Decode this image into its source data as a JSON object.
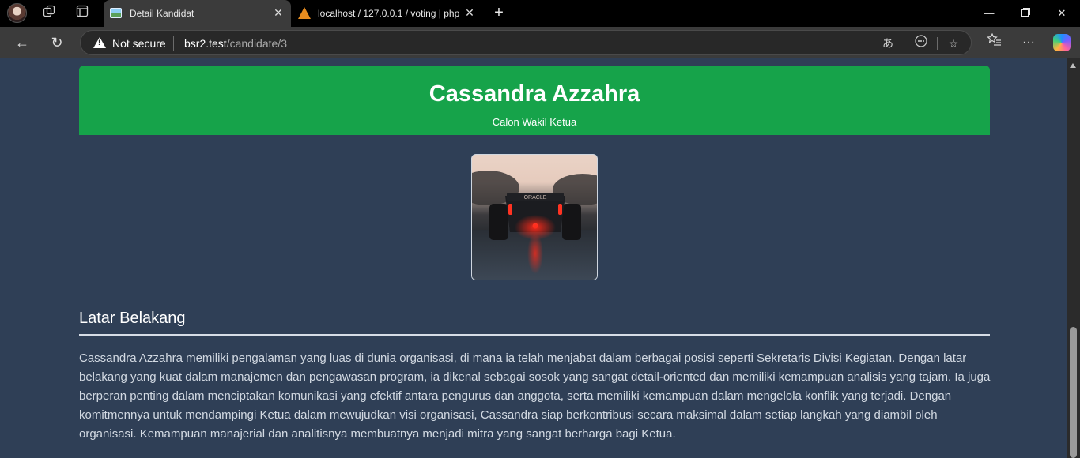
{
  "browser": {
    "tabs": [
      {
        "title": "Detail Kandidat",
        "active": true
      },
      {
        "title": "localhost / 127.0.0.1 / voting | php",
        "active": false
      }
    ],
    "address": {
      "security_label": "Not secure",
      "host": "bsr2.test",
      "path": "/candidate/3"
    },
    "icons": {
      "workspaces": "workspaces-icon",
      "tab_actions": "tab-actions-icon",
      "back": "back-arrow-icon",
      "refresh": "refresh-icon",
      "read_aloud": "read-aloud-icon",
      "more_tools": "more-tools-icon",
      "favorite": "star-icon",
      "favorites": "favorites-icon",
      "menu": "more-menu-icon",
      "copilot": "copilot-icon"
    }
  },
  "candidate": {
    "name": "Cassandra Azzahra",
    "role": "Calon Wakil Ketua",
    "photo_alt": "Cassandra Azzahra",
    "section_title": "Latar Belakang",
    "bio": "Cassandra Azzahra memiliki pengalaman yang luas di dunia organisasi, di mana ia telah menjabat dalam berbagai posisi seperti Sekretaris Divisi Kegiatan. Dengan latar belakang yang kuat dalam manajemen dan pengawasan program, ia dikenal sebagai sosok yang sangat detail-oriented dan memiliki kemampuan analisis yang tajam. Ia juga berperan penting dalam menciptakan komunikasi yang efektif antara pengurus dan anggota, serta memiliki kemampuan dalam mengelola konflik yang terjadi. Dengan komitmennya untuk mendampingi Ketua dalam mewujudkan visi organisasi, Cassandra siap berkontribusi secara maksimal dalam setiap langkah yang diambil oleh organisasi. Kemampuan manajerial dan analitisnya membuatnya menjadi mitra yang sangat berharga bagi Ketua."
  },
  "colors": {
    "header_green": "#16a34a",
    "page_background": "#2f3f56"
  }
}
